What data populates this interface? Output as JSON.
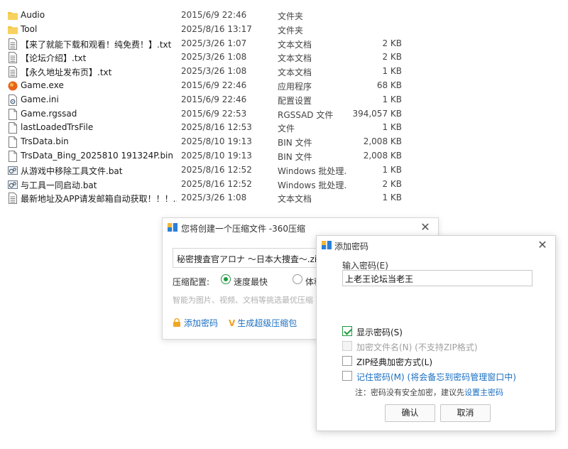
{
  "files": [
    {
      "icon": "folder-icon",
      "name": "Audio",
      "date": "2015/6/9 22:46",
      "type": "文件夹",
      "size": ""
    },
    {
      "icon": "folder-icon",
      "name": "Tool",
      "date": "2025/8/16 13:17",
      "type": "文件夹",
      "size": ""
    },
    {
      "icon": "text-file-icon",
      "name": "【来了就能下载和观看！纯免费！】.txt",
      "date": "2025/3/26 1:07",
      "type": "文本文档",
      "size": "2 KB"
    },
    {
      "icon": "text-file-icon",
      "name": "【论坛介绍】.txt",
      "date": "2025/3/26 1:08",
      "type": "文本文档",
      "size": "2 KB"
    },
    {
      "icon": "text-file-icon",
      "name": "【永久地址发布页】.txt",
      "date": "2025/3/26 1:08",
      "type": "文本文档",
      "size": "1 KB"
    },
    {
      "icon": "exe-icon",
      "name": "Game.exe",
      "date": "2015/6/9 22:46",
      "type": "应用程序",
      "size": "68 KB"
    },
    {
      "icon": "ini-file-icon",
      "name": "Game.ini",
      "date": "2015/6/9 22:46",
      "type": "配置设置",
      "size": "1 KB"
    },
    {
      "icon": "blank-file-icon",
      "name": "Game.rgssad",
      "date": "2015/6/9 22:53",
      "type": "RGSSAD 文件",
      "size": "394,057 KB"
    },
    {
      "icon": "blank-file-icon",
      "name": "lastLoadedTrsFile",
      "date": "2025/8/16 12:53",
      "type": "文件",
      "size": "1 KB"
    },
    {
      "icon": "blank-file-icon",
      "name": "TrsData.bin",
      "date": "2025/8/10 19:13",
      "type": "BIN 文件",
      "size": "2,008 KB"
    },
    {
      "icon": "blank-file-icon",
      "name": "TrsData_Bing_2025810 191324P.bin",
      "date": "2025/8/10 19:13",
      "type": "BIN 文件",
      "size": "2,008 KB"
    },
    {
      "icon": "bat-file-icon",
      "name": "从游戏中移除工具文件.bat",
      "date": "2025/8/16 12:52",
      "type": "Windows 批处理...",
      "size": "1 KB"
    },
    {
      "icon": "bat-file-icon",
      "name": "与工具一同启动.bat",
      "date": "2025/8/16 12:52",
      "type": "Windows 批处理...",
      "size": "2 KB"
    },
    {
      "icon": "text-file-icon",
      "name": "最新地址及APP请发邮箱自动获取！！！...",
      "date": "2025/3/26 1:08",
      "type": "文本文档",
      "size": "1 KB"
    }
  ],
  "compress_dialog": {
    "title": "您将创建一个压缩文件 -360压缩",
    "close": "✕",
    "filename": "秘密捜査官アロナ ～日本大捜査～.zip",
    "config_label": "压缩配置:",
    "option_fast": "速度最快",
    "option_small": "体积",
    "hint": "智能为图片、视频、文档等挑选最优压缩",
    "add_password": "添加密码",
    "super_zip_mark": "V",
    "super_zip": "生成超级压缩包"
  },
  "password_dialog": {
    "title": "添加密码",
    "close": "✕",
    "input_label": "输入密码(E)",
    "password_value": "上老王论坛当老王",
    "show_password": "显示密码(S)",
    "encrypt_filenames": "加密文件名(N) (不支持ZIP格式)",
    "zip_classic": "ZIP经典加密方式(L)",
    "remember_password": "记住密码(M) (将会备忘到密码管理窗口中)",
    "note_prefix": "注：密码没有安全加密，建议先",
    "note_link": "设置主密码",
    "ok": "确认",
    "cancel": "取消"
  },
  "colors": {
    "accent_green": "#1f9a3f",
    "link_blue": "#1a6fc2",
    "folder_yellow": "#f5c542"
  }
}
